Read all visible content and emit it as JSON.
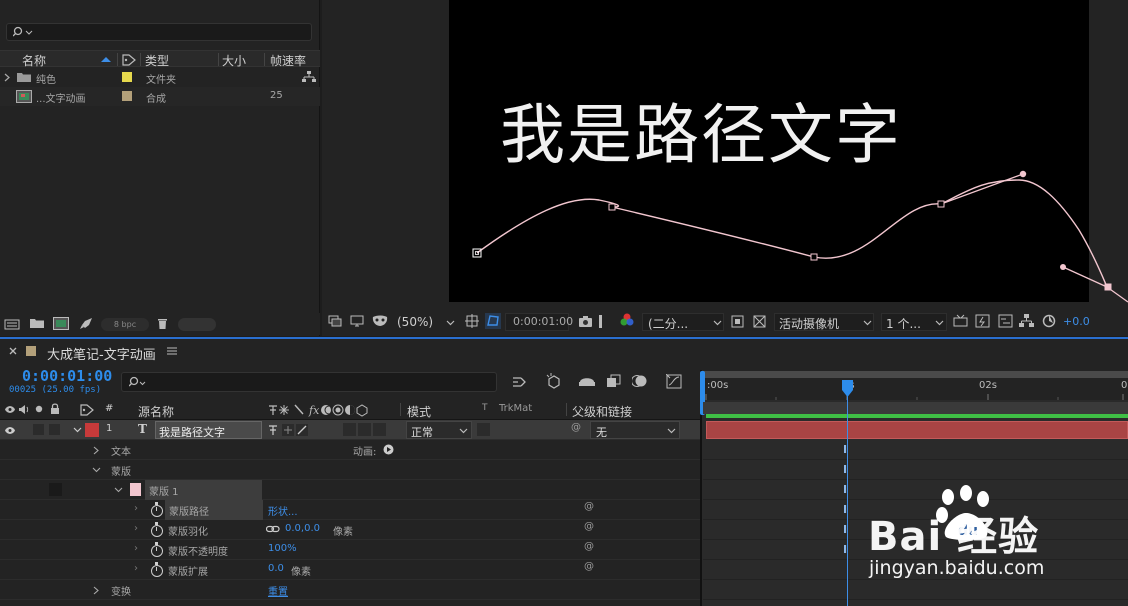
{
  "project_panel": {
    "columns": {
      "name": "名称",
      "type": "类型",
      "size": "大小",
      "fps": "帧速率"
    },
    "items": [
      {
        "name": "纯色",
        "type": "文件夹",
        "fps": "",
        "color": "#e6d94d",
        "icon": "folder-icon"
      },
      {
        "name": "...文字动画",
        "type": "合成",
        "fps": "25",
        "color": "#b3a07a",
        "icon": "composition-icon"
      }
    ],
    "bottom": {
      "bpc": "8 bpc"
    }
  },
  "viewer": {
    "canvas_text": "我是路径文字",
    "toolbar": {
      "zoom": "(50%)",
      "timecode": "0:00:01:00",
      "resolution": "(二分...",
      "camera": "活动摄像机",
      "views": "1 个...",
      "exposure": "+0.0"
    }
  },
  "timeline": {
    "tab_title": "大成笔记-文字动画",
    "timecode": "0:00:01:00",
    "framecode": "00025 (25.00 fps)",
    "columns": {
      "num": "#",
      "source_name": "源名称",
      "mode": "模式",
      "trkmat_t": "T",
      "trkmat": "TrkMat",
      "parent": "父级和链接"
    },
    "layer": {
      "number": "1",
      "name": "我是路径文字",
      "mode": "正常",
      "parent": "无",
      "label_color": "#c73a3a"
    },
    "rows": {
      "text": "文本",
      "animate": "动画:",
      "masks": "蒙版",
      "mask1": "蒙版 1",
      "mask_path": "蒙版路径",
      "mask_path_value": "形状...",
      "mask_feather": "蒙版羽化",
      "mask_feather_value": "0.0,0.0",
      "mask_feather_unit": "像素",
      "mask_opacity": "蒙版不透明度",
      "mask_opacity_value": "100%",
      "mask_expansion": "蒙版扩展",
      "mask_expansion_value": "0.0",
      "mask_expansion_unit": "像素",
      "transform": "变换",
      "reset": "重置"
    },
    "ruler": {
      "t0": ":00s",
      "t1": "0s",
      "t2": "02s",
      "t3": "0"
    },
    "current_time_fraction": 0.5
  },
  "watermark": {
    "line1": "Bai 经验",
    "line2": "jingyan.baidu.com"
  },
  "colors": {
    "accent": "#2d8ceb",
    "mask_path": "#f2c6cf",
    "layer_bar": "#a94444",
    "green_bar": "#3fbf45"
  }
}
